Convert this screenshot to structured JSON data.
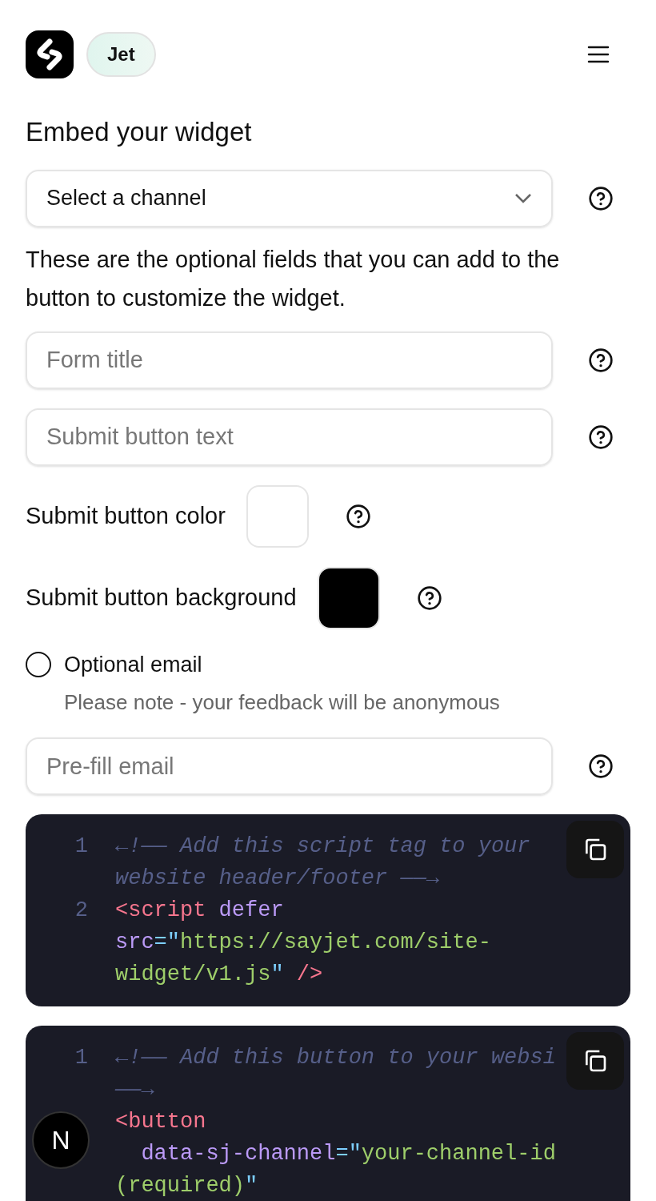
{
  "header": {
    "badge": "Jet"
  },
  "title": "Embed your widget",
  "channel_select": {
    "value": "Select a channel"
  },
  "description": "These are the optional fields that you can add to the button to customize the widget.",
  "fields": [
    {
      "kind": "text",
      "placeholder": "Form title"
    },
    {
      "kind": "text",
      "placeholder": "Submit button text"
    },
    {
      "kind": "color",
      "label": "Submit button color",
      "color": "#ffffff"
    },
    {
      "kind": "color",
      "label": "Submit button background",
      "color": "#000000"
    },
    {
      "kind": "radio",
      "label": "Optional email",
      "selected": false,
      "note": "Please note - your feedback will be anonymous"
    },
    {
      "kind": "text",
      "placeholder": "Pre-fill email"
    }
  ],
  "code_blocks": [
    {
      "rows": [
        {
          "number": "1",
          "tokens": [
            {
              "kind": "comment",
              "text": "←!—— Add this script tag to your"
            }
          ]
        },
        {
          "tokens": [
            {
              "kind": "comment",
              "text": "website header/footer ——→"
            }
          ]
        },
        {
          "number": "2",
          "tokens": [
            {
              "kind": "tag",
              "text": "<script"
            },
            {
              "kind": "space"
            },
            {
              "kind": "attr",
              "text": "defer"
            }
          ]
        },
        {
          "tokens": [
            {
              "kind": "attr",
              "text": "src"
            },
            {
              "kind": "punct",
              "text": "=\""
            },
            {
              "kind": "string",
              "text": "https://sayjet.com/site-"
            }
          ]
        },
        {
          "tokens": [
            {
              "kind": "string",
              "text": "widget/v1.js"
            },
            {
              "kind": "punct",
              "text": "\""
            },
            {
              "kind": "space"
            },
            {
              "kind": "tag",
              "text": "/>"
            }
          ]
        }
      ]
    },
    {
      "rows": [
        {
          "number": "1",
          "tokens": [
            {
              "kind": "comment",
              "text": "←!—— Add this button to your websi"
            }
          ]
        },
        {
          "tokens": [
            {
              "kind": "comment",
              "text": "——→"
            }
          ]
        },
        {
          "tokens": [
            {
              "kind": "tag",
              "text": "<button"
            }
          ]
        },
        {
          "tokens": [
            {
              "kind": "indent"
            },
            {
              "kind": "attr",
              "text": "data-sj-channel"
            },
            {
              "kind": "punct",
              "text": "=\""
            },
            {
              "kind": "string",
              "text": "your-channel-id"
            }
          ]
        },
        {
          "tokens": [
            {
              "kind": "string",
              "text": "(required)"
            },
            {
              "kind": "punct",
              "text": "\""
            }
          ]
        }
      ]
    }
  ],
  "floating_badge": {
    "text": "N"
  }
}
